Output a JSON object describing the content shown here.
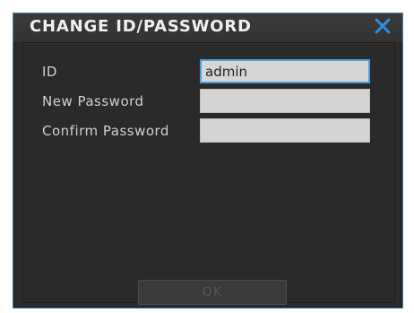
{
  "dialog": {
    "title": "CHANGE ID/PASSWORD",
    "close_icon": "close-icon",
    "accent_color": "#4a9fd8"
  },
  "form": {
    "id_label": "ID",
    "id_value": "admin",
    "new_password_label": "New Password",
    "new_password_value": "",
    "confirm_password_label": "Confirm Password",
    "confirm_password_value": ""
  },
  "actions": {
    "ok_label": "OK",
    "ok_enabled": false
  }
}
